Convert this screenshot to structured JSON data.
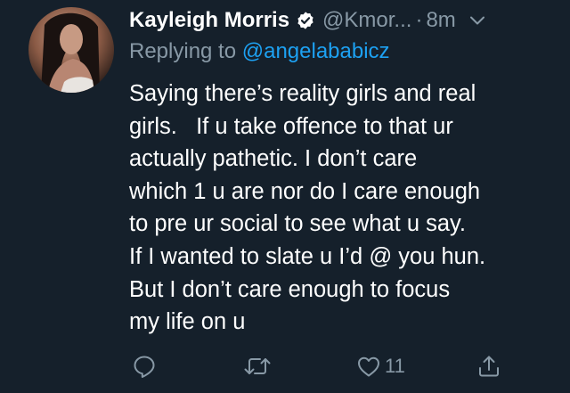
{
  "tweet": {
    "author_name": "Kayleigh Morris",
    "handle": "@Kmor...",
    "separator": "·",
    "time": "8m",
    "reply_prefix": "Replying to",
    "reply_to": "@angelababicz",
    "text_lines": [
      "Saying there’s reality girls and real",
      "girls.   If u take offence to that ur",
      "actually pathetic. I don’t care",
      "which 1 u are nor do I care enough",
      "to pre ur social to see what u say.",
      "If I wanted to slate u I’d @ you hun.",
      "But I don’t care enough to focus",
      "my life on u"
    ],
    "like_count": "11"
  },
  "icons": {
    "verified": "verified-badge-icon",
    "menu": "chevron-down-icon",
    "reply": "reply-icon",
    "retweet": "retweet-icon",
    "like": "heart-icon",
    "share": "share-icon"
  },
  "colors": {
    "background": "#15202b",
    "text": "#ffffff",
    "muted": "#8899a6",
    "accent": "#1da1f2"
  }
}
